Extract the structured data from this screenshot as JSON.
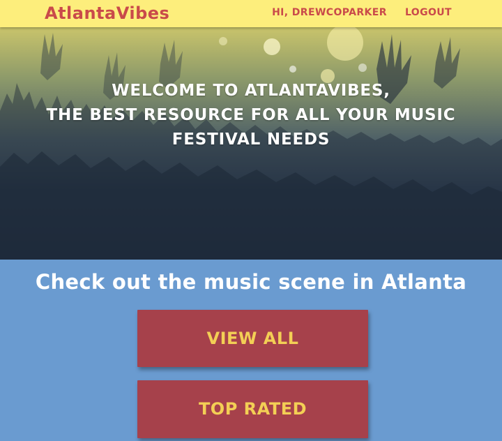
{
  "navbar": {
    "brand": "AtlantaVibes",
    "greeting": "Hi, drewcoparker",
    "logout_label": "Logout"
  },
  "hero": {
    "line1": "Welcome to AtlantaVibes,",
    "line2": "the best resource for all your music",
    "line3": "festival needs"
  },
  "main": {
    "heading": "Check out the music scene in Atlanta",
    "view_all_label": "View All",
    "top_rated_label": "Top Rated"
  },
  "colors": {
    "navbar_bg": "#fdee7c",
    "brand": "#c94a4a",
    "page_bg": "#6a9bd0",
    "button_bg": "#a6414b",
    "button_text": "#f3cf55"
  }
}
